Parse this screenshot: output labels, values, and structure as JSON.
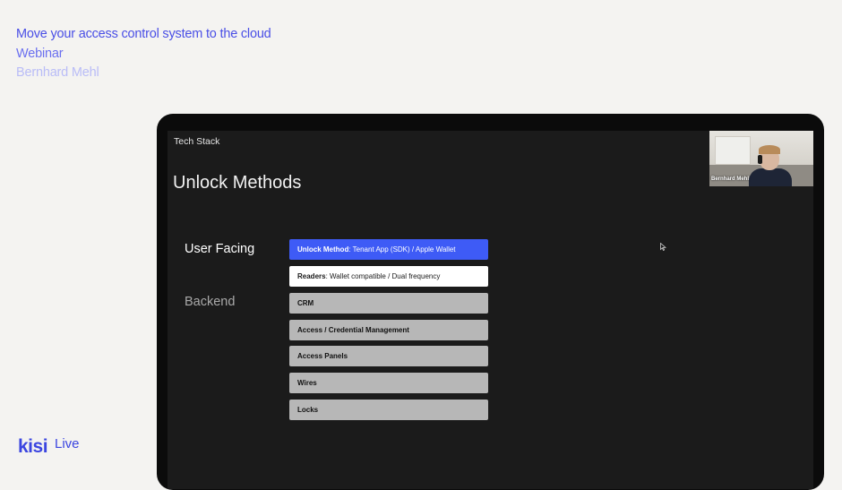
{
  "header": {
    "title": "Move your access control system to the cloud",
    "subtitle": "Webinar",
    "presenter": "Bernhard Mehl"
  },
  "slide": {
    "label": "Tech Stack",
    "title": "Unlock Methods",
    "sections": {
      "user_facing": "User Facing",
      "backend": "Backend"
    },
    "rows": [
      {
        "bold": "Unlock Method",
        "text": ": Tenant App (SDK) / Apple Wallet",
        "style": "blue"
      },
      {
        "bold": "Readers",
        "text": ": Wallet compatible / Dual frequency",
        "style": "white"
      },
      {
        "bold": "CRM",
        "text": "",
        "style": "gray"
      },
      {
        "bold": "Access / Credential Management",
        "text": "",
        "style": "gray"
      },
      {
        "bold": "Access Panels",
        "text": "",
        "style": "gray"
      },
      {
        "bold": "Wires",
        "text": "",
        "style": "gray"
      },
      {
        "bold": "Locks",
        "text": "",
        "style": "gray"
      }
    ]
  },
  "video": {
    "participant_name": "Bernhard Mehl"
  },
  "logo": {
    "brand": "kisi",
    "suffix": "Live"
  },
  "colors": {
    "accent": "#4a4fe6",
    "row_blue": "#3e5bf6",
    "row_gray": "#b7b7b7",
    "screen_bg": "#1b1b1b"
  },
  "icons": [
    "mouse-cursor-icon"
  ]
}
